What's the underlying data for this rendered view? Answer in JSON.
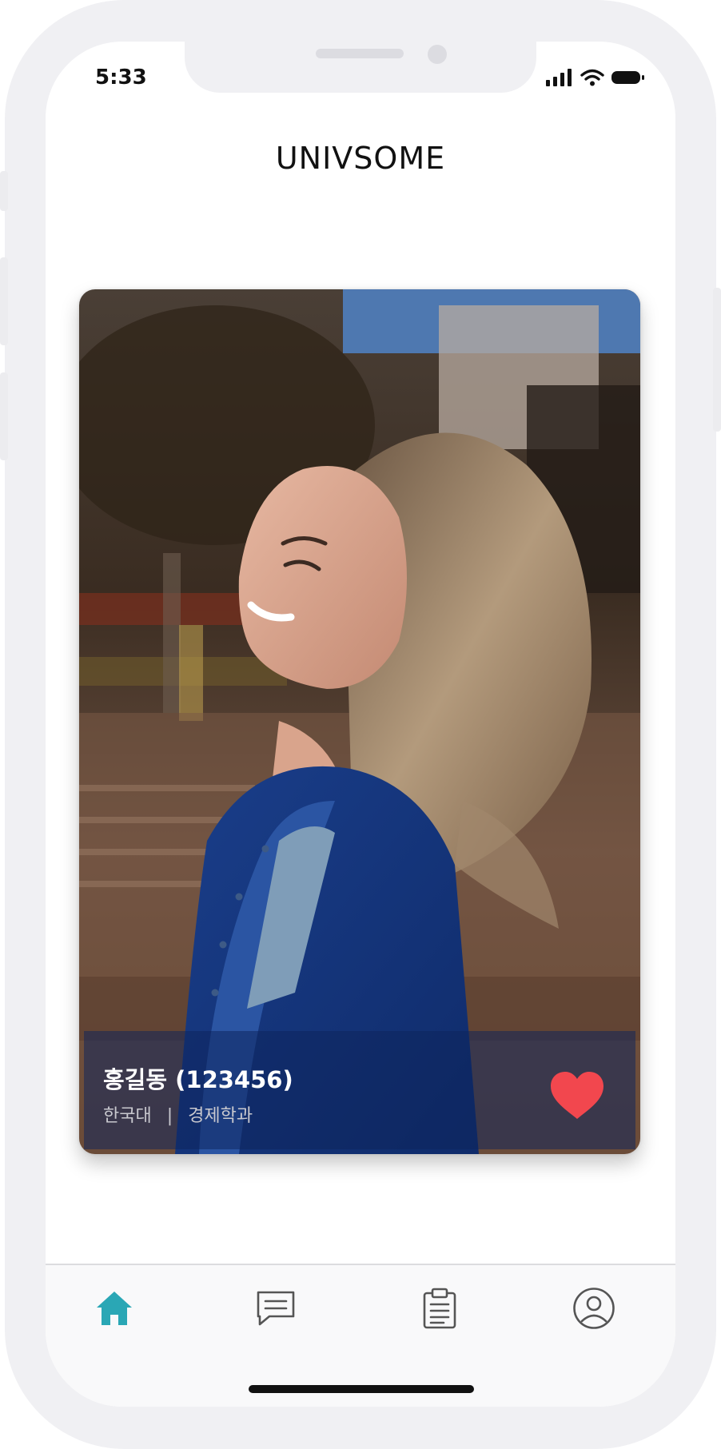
{
  "status_bar": {
    "time": "5:33"
  },
  "header": {
    "title": "UNIVSOME"
  },
  "profile": {
    "name": "홍길동 (123456)",
    "university": "한국대",
    "separator": "|",
    "department": "경제학과"
  },
  "icons": {
    "like": "heart-icon",
    "tabs": [
      "home-icon",
      "chat-icon",
      "clipboard-icon",
      "profile-icon"
    ]
  },
  "tabbar": {
    "active_index": 0
  },
  "colors": {
    "accent": "#2aa7b5",
    "like": "#f2474e",
    "inactive_icon": "#555555",
    "frame": "#f0f0f3"
  }
}
